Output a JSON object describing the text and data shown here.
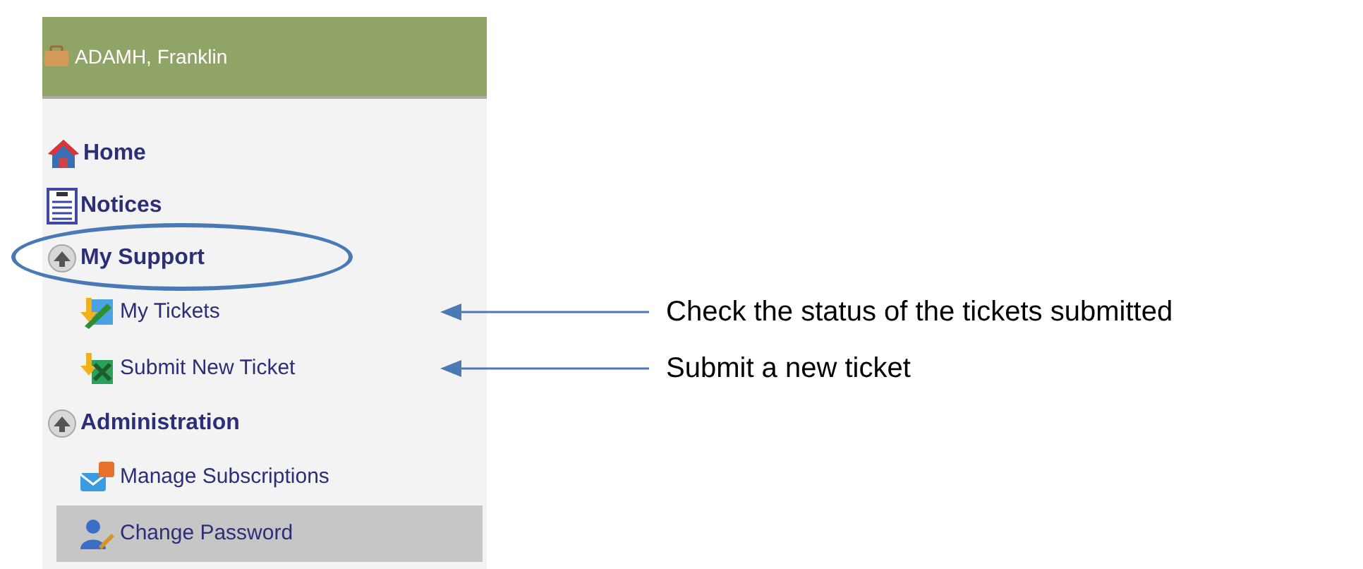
{
  "user": {
    "name": "ADAMH, Franklin"
  },
  "nav": [
    {
      "kind": "link",
      "label": "Home",
      "selected": false
    },
    {
      "kind": "link",
      "label": "Notices",
      "selected": false
    },
    {
      "kind": "section",
      "label": "My Support",
      "expanded": true,
      "highlighted": true,
      "selected": false
    },
    {
      "kind": "sub",
      "label": "My Tickets",
      "selected": false,
      "note": "Check the status of the tickets submitted"
    },
    {
      "kind": "sub",
      "label": "Submit New Ticket",
      "selected": false,
      "note": "Submit a new ticket"
    },
    {
      "kind": "section",
      "label": "Administration",
      "expanded": true,
      "highlighted": false,
      "selected": false
    },
    {
      "kind": "sub",
      "label": "Manage Subscriptions",
      "selected": false
    },
    {
      "kind": "sub",
      "label": "Change Password",
      "selected": true
    }
  ]
}
